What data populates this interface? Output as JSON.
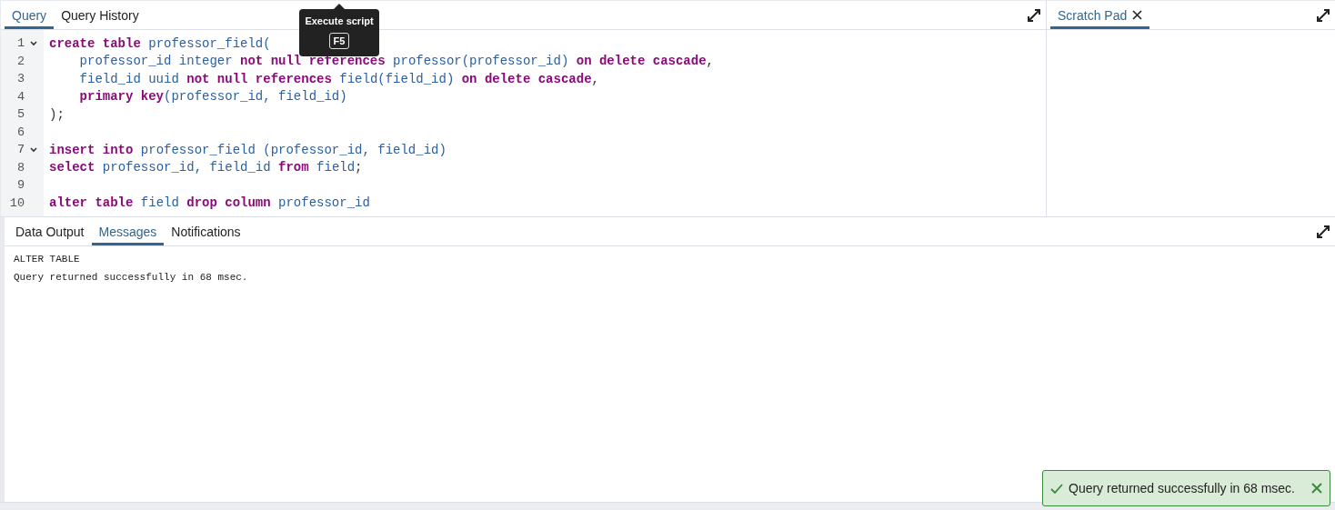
{
  "editor_tabs": [
    {
      "label": "Query",
      "selected": true
    },
    {
      "label": "Query History",
      "selected": false
    }
  ],
  "tooltip": {
    "text": "Execute script",
    "shortcut": "F5"
  },
  "code_lines": [
    {
      "number": "1",
      "foldable": true,
      "tokens": [
        {
          "kind": "kw",
          "text": "create table"
        },
        {
          "kind": "id",
          "text": " professor_field("
        }
      ]
    },
    {
      "number": "2",
      "foldable": false,
      "tokens": [
        {
          "kind": "id",
          "text": "    professor_id integer "
        },
        {
          "kind": "kw",
          "text": "not null references"
        },
        {
          "kind": "id",
          "text": " professor(professor_id) "
        },
        {
          "kind": "kw",
          "text": "on delete cascade"
        },
        {
          "kind": "punct",
          "text": ","
        }
      ]
    },
    {
      "number": "3",
      "foldable": false,
      "tokens": [
        {
          "kind": "id",
          "text": "    field_id uuid "
        },
        {
          "kind": "kw",
          "text": "not null references"
        },
        {
          "kind": "id",
          "text": " field(field_id) "
        },
        {
          "kind": "kw",
          "text": "on delete cascade"
        },
        {
          "kind": "punct",
          "text": ","
        }
      ]
    },
    {
      "number": "4",
      "foldable": false,
      "tokens": [
        {
          "kind": "kw",
          "text": "    primary key"
        },
        {
          "kind": "id",
          "text": "(professor_id, field_id)"
        }
      ]
    },
    {
      "number": "5",
      "foldable": false,
      "tokens": [
        {
          "kind": "punct",
          "text": ");"
        }
      ]
    },
    {
      "number": "6",
      "foldable": false
    },
    {
      "number": "7",
      "foldable": true,
      "tokens": [
        {
          "kind": "kw",
          "text": "insert into"
        },
        {
          "kind": "id",
          "text": " professor_field (professor_id, field_id)"
        }
      ]
    },
    {
      "number": "8",
      "foldable": false,
      "tokens": [
        {
          "kind": "kw",
          "text": "select"
        },
        {
          "kind": "id",
          "text": " professor_id, field_id "
        },
        {
          "kind": "kw",
          "text": "from"
        },
        {
          "kind": "id",
          "text": " field"
        },
        {
          "kind": "punct",
          "text": ";"
        }
      ]
    },
    {
      "number": "9",
      "foldable": false
    },
    {
      "number": "10",
      "foldable": false,
      "tokens": [
        {
          "kind": "kw",
          "text": "alter table"
        },
        {
          "kind": "id",
          "text": " field "
        },
        {
          "kind": "kw",
          "text": "drop column"
        },
        {
          "kind": "id",
          "text": " professor_id"
        }
      ]
    }
  ],
  "scratch_tabs": [
    {
      "label": "Scratch Pad",
      "selected": true
    }
  ],
  "output_tabs": [
    {
      "label": "Data Output",
      "selected": false
    },
    {
      "label": "Messages",
      "selected": true
    },
    {
      "label": "Notifications",
      "selected": false
    }
  ],
  "messages": [
    "ALTER TABLE",
    "Query returned successfully in 68 msec."
  ],
  "toast": {
    "text": "Query returned successfully in 68 msec."
  }
}
